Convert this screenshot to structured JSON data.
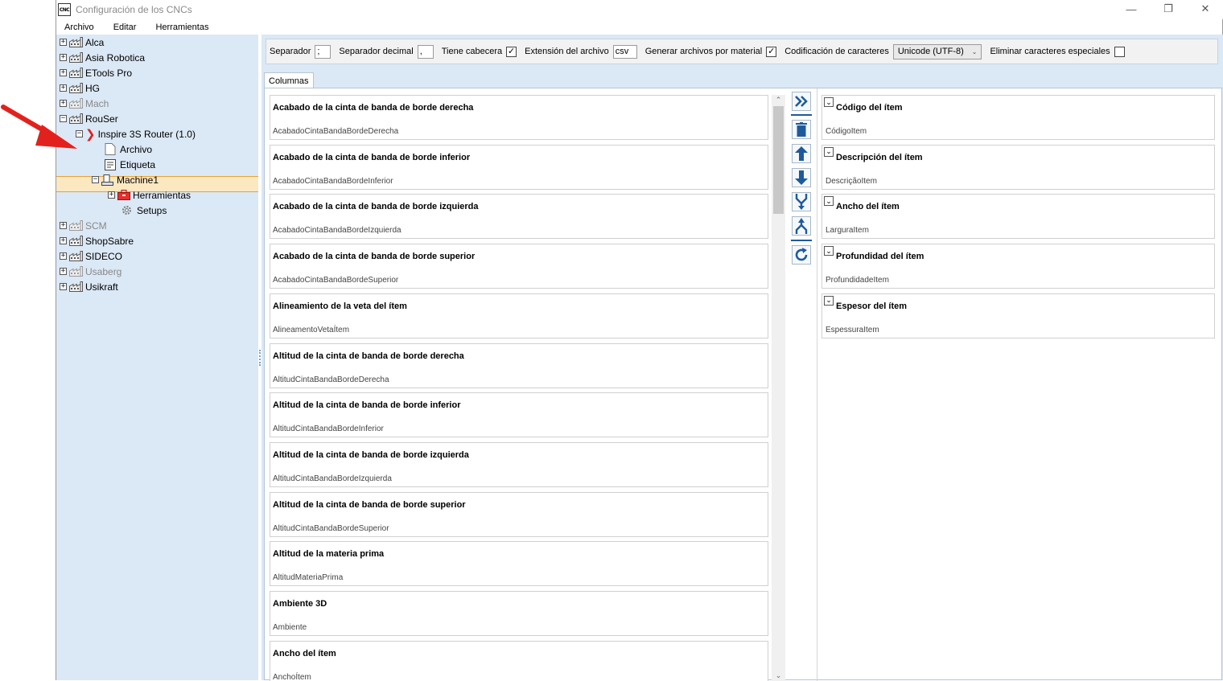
{
  "window": {
    "title": "Configuración de los CNCs",
    "app_icon_label": "CNC"
  },
  "menu": [
    "Archivo",
    "Editar",
    "Herramientas"
  ],
  "tree": {
    "manufacturers_top": [
      {
        "label": "Alca",
        "muted": false
      },
      {
        "label": "Asia Robotica",
        "muted": false
      },
      {
        "label": "ETools Pro",
        "muted": false
      },
      {
        "label": "HG",
        "muted": false
      },
      {
        "label": "Mach",
        "muted": true
      },
      {
        "label": "RouSer",
        "muted": false
      }
    ],
    "machine": "Inspire 3S Router (1.0)",
    "archivo": "Archivo",
    "etiqueta": "Etiqueta",
    "machine1": "Machine1",
    "herramientas": "Herramientas",
    "setups": "Setups",
    "manufacturers_bottom": [
      {
        "label": "SCM",
        "muted": true
      },
      {
        "label": "ShopSabre",
        "muted": false
      },
      {
        "label": "SIDECO",
        "muted": false
      },
      {
        "label": "Usaberg",
        "muted": true
      },
      {
        "label": "Usikraft",
        "muted": false
      }
    ]
  },
  "options": {
    "separador_label": "Separador",
    "separador_value": ";",
    "separador_decimal_label": "Separador decimal",
    "separador_decimal_value": ",",
    "tiene_cabecera_label": "Tiene cabecera",
    "tiene_cabecera_checked": "✓",
    "extension_label": "Extensión del archivo",
    "extension_value": "csv",
    "generar_label": "Generar archivos por material",
    "generar_checked": "✓",
    "codificacion_label": "Codificación de caracteres",
    "codificacion_value": "Unicode (UTF-8)",
    "eliminar_label": "Eliminar caracteres especiales",
    "eliminar_checked": ""
  },
  "tab_label": "Columnas",
  "available_columns": [
    {
      "title": "Acabado de la cinta de banda de borde derecha",
      "key": "AcabadoCintaBandaBordeDerecha"
    },
    {
      "title": "Acabado de la cinta de banda de borde inferior",
      "key": "AcabadoCintaBandaBordeInferior"
    },
    {
      "title": "Acabado de la cinta de banda de borde izquierda",
      "key": "AcabadoCintaBandaBordeIzquierda"
    },
    {
      "title": "Acabado de la cinta de banda de borde superior",
      "key": "AcabadoCintaBandaBordeSuperior"
    },
    {
      "title": "Alineamiento de la veta del ítem",
      "key": "AlineamentoVetaÍtem"
    },
    {
      "title": "Altitud de la cinta de banda de borde derecha",
      "key": "AltitudCintaBandaBordeDerecha"
    },
    {
      "title": "Altitud de la cinta de banda de borde inferior",
      "key": "AltitudCintaBandaBordeInferior"
    },
    {
      "title": "Altitud de la cinta de banda de borde izquierda",
      "key": "AltitudCintaBandaBordeIzquierda"
    },
    {
      "title": "Altitud de la cinta de banda de borde superior",
      "key": "AltitudCintaBandaBordeSuperior"
    },
    {
      "title": "Altitud de la materia prima",
      "key": "AltitudMateriaPrima"
    },
    {
      "title": "Ambiente 3D",
      "key": "Ambiente"
    },
    {
      "title": "Ancho del ítem",
      "key": "AnchoÍtem"
    }
  ],
  "selected_columns": [
    {
      "title": "Código del ítem",
      "key": "CódigoItem"
    },
    {
      "title": "Descripción del ítem",
      "key": "DescriçãoItem"
    },
    {
      "title": "Ancho del ítem",
      "key": "LarguraItem"
    },
    {
      "title": "Profundidad del ítem",
      "key": "ProfundidadeItem"
    },
    {
      "title": "Espesor del ítem",
      "key": "EspessuraItem"
    }
  ],
  "toolbar_icons": [
    "add-all-icon",
    "delete-icon",
    "move-up-icon",
    "move-down-icon",
    "merge-icon",
    "split-icon",
    "refresh-icon"
  ]
}
